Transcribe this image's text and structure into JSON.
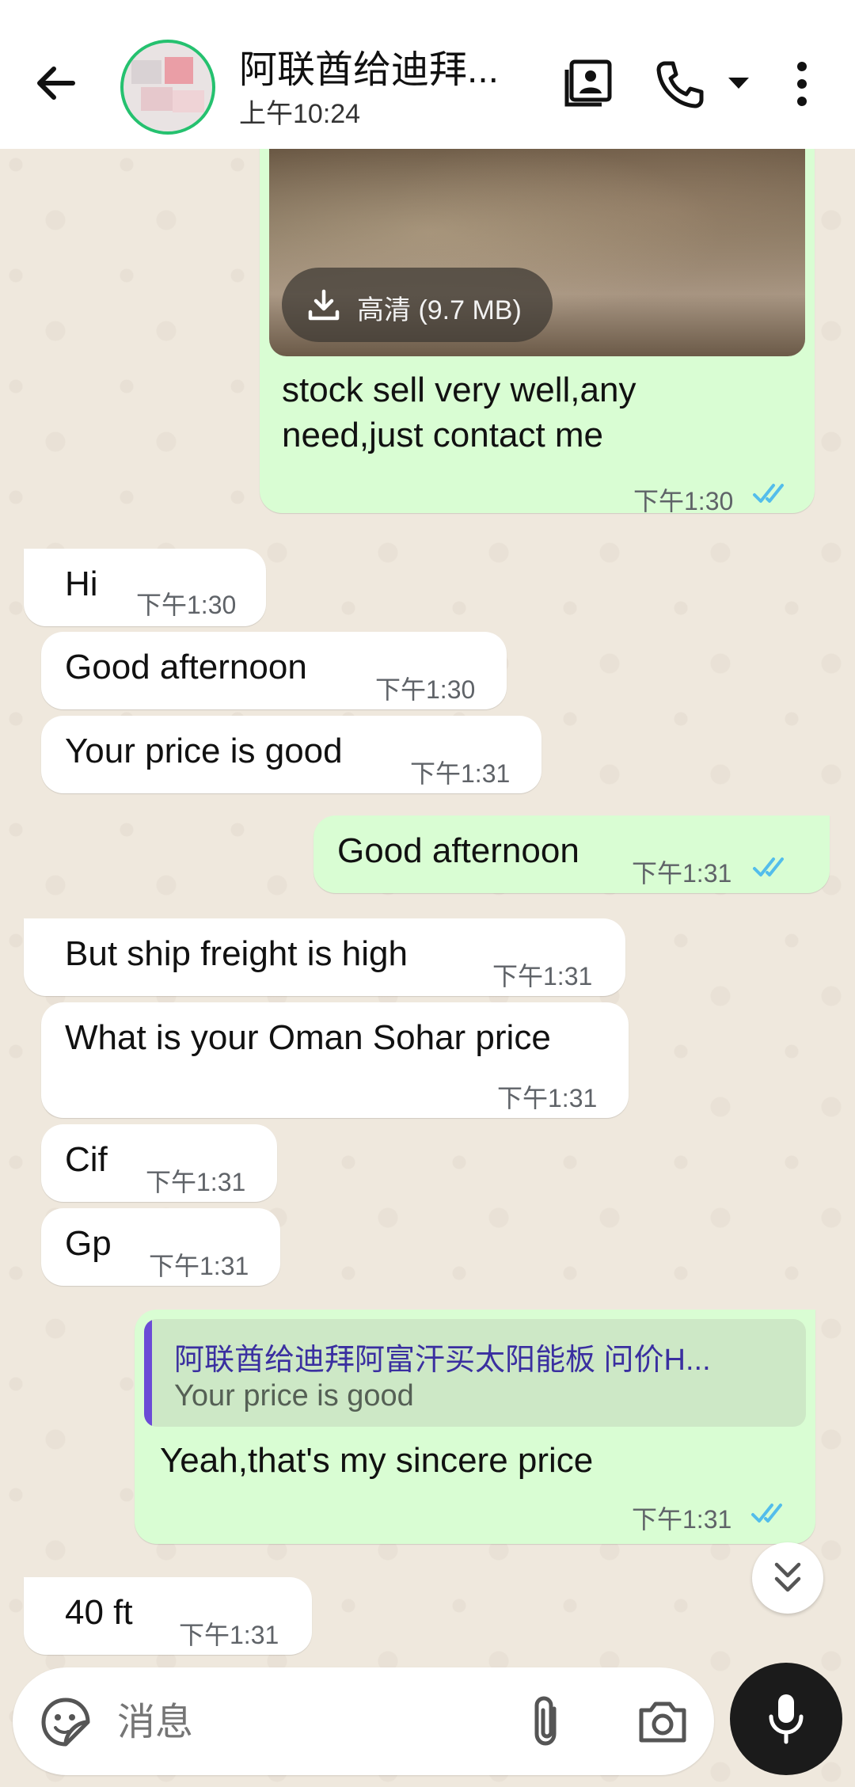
{
  "header": {
    "contact_name": "阿联酋给迪拜...",
    "status": "上午10:24",
    "icons": [
      "back-arrow-icon",
      "contact-avatar",
      "video-call-icon",
      "voice-call-icon",
      "dropdown-icon",
      "more-options-icon"
    ]
  },
  "messages": [
    {
      "dir": "out",
      "text_line1": "stock sell very well,any",
      "text_line2": "need,just contact me",
      "time": "下午1:30",
      "media_download_label": "高清 (9.7 MB)",
      "read": true
    },
    {
      "dir": "in",
      "text": "Hi",
      "time": "下午1:30"
    },
    {
      "dir": "in",
      "text": "Good afternoon",
      "time": "下午1:30"
    },
    {
      "dir": "in",
      "text": "Your price is good",
      "time": "下午1:31"
    },
    {
      "dir": "out",
      "text": "Good afternoon",
      "time": "下午1:31",
      "read": true
    },
    {
      "dir": "in",
      "text": "But ship freight is high",
      "time": "下午1:31"
    },
    {
      "dir": "in",
      "text": "What is your Oman Sohar price",
      "time": "下午1:31"
    },
    {
      "dir": "in",
      "text": "Cif",
      "time": "下午1:31"
    },
    {
      "dir": "in",
      "text": "Gp",
      "time": "下午1:31"
    },
    {
      "dir": "out",
      "quote_name": "阿联酋给迪拜阿富汗买太阳能板 问价H...",
      "quote_text": "Your price is good",
      "text": "Yeah,that's my sincere price",
      "time": "下午1:31",
      "read": true
    },
    {
      "dir": "in",
      "text": "40 ft",
      "time": "下午1:31"
    }
  ],
  "composer": {
    "placeholder": "消息",
    "icons": [
      "sticker-icon",
      "attach-icon",
      "camera-icon",
      "mic-icon"
    ]
  },
  "colors": {
    "outgoing_bubble": "#d9fdd3",
    "incoming_bubble": "#ffffff",
    "read_ticks": "#53bdeb",
    "avatar_ring": "#25c16f"
  }
}
